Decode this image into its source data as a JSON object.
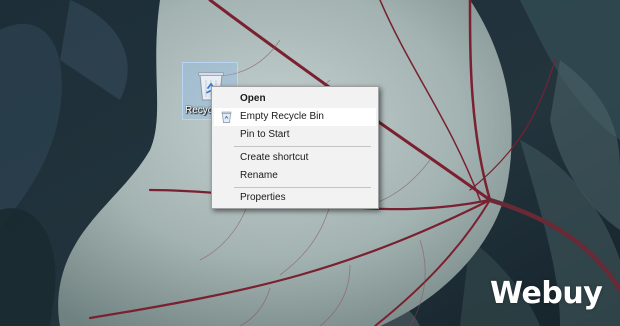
{
  "desktop": {
    "icon": {
      "name": "recycle-bin",
      "label": "Recycle Bin"
    }
  },
  "context_menu": {
    "items": [
      {
        "label": "Open",
        "bold": true,
        "highlighted": false,
        "icon": null
      },
      {
        "label": "Empty Recycle Bin",
        "bold": false,
        "highlighted": true,
        "icon": "recycle-bin-icon"
      },
      {
        "label": "Pin to Start",
        "bold": false,
        "highlighted": false,
        "icon": null
      },
      {
        "label": "Create shortcut",
        "bold": false,
        "highlighted": false,
        "icon": null
      },
      {
        "label": "Rename",
        "bold": false,
        "highlighted": false,
        "icon": null
      },
      {
        "label": "Properties",
        "bold": false,
        "highlighted": false,
        "icon": null
      }
    ]
  },
  "watermark": {
    "text": "Webuy"
  },
  "colors": {
    "menu_background": "#f2f2f2",
    "menu_border": "#a0a0a0",
    "menu_highlight": "#ffffff",
    "icon_selection": "#8cbef0",
    "leaf_vein": "#7a2030",
    "leaf_surface": "#a8b8b8"
  }
}
